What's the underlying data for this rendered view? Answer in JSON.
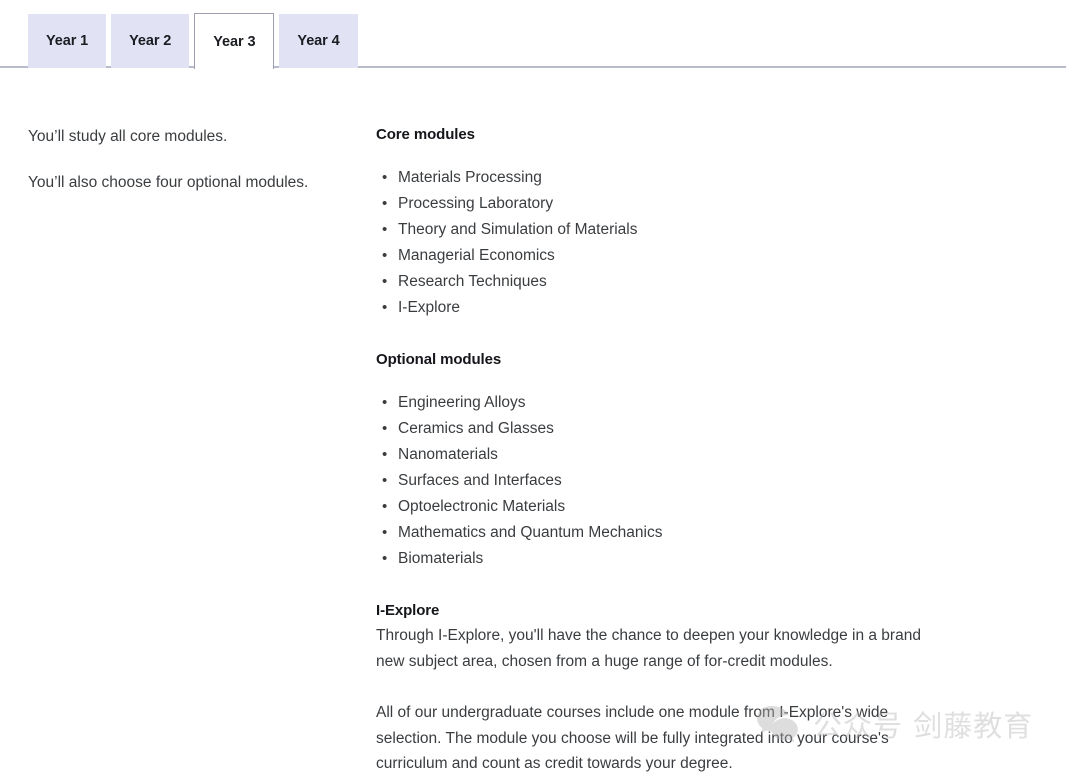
{
  "tabs": {
    "items": [
      {
        "label": "Year 1",
        "active": false
      },
      {
        "label": "Year 2",
        "active": false
      },
      {
        "label": "Year 3",
        "active": true
      },
      {
        "label": "Year 4",
        "active": false
      }
    ],
    "active_label": "Year 3"
  },
  "left_column": {
    "paragraph_1": "You’ll study all core modules.",
    "paragraph_2": "You’ll also choose four optional modules."
  },
  "right_column": {
    "core": {
      "heading": "Core modules",
      "items": [
        "Materials Processing",
        "Processing Laboratory",
        "Theory and Simulation of Materials",
        "Managerial Economics",
        "Research Techniques",
        "I-Explore"
      ]
    },
    "optional": {
      "heading": "Optional modules",
      "items": [
        "Engineering Alloys",
        "Ceramics and Glasses",
        "Nanomaterials",
        "Surfaces and Interfaces",
        "Optoelectronic Materials",
        "Mathematics and Quantum Mechanics",
        "Biomaterials"
      ]
    },
    "iexplore": {
      "heading": "I-Explore",
      "paragraph_1": "Through I-Explore, you'll have the chance to deepen your knowledge in a brand new subject area, chosen from a huge range of for-credit modules.",
      "paragraph_2": "All of our undergraduate courses include one module from I-Explore's wide selection. The module you choose will be fully integrated into your course's curriculum and count as credit towards your degree."
    }
  },
  "watermark": {
    "icon": "wechat-logo-icon",
    "text": "公众号  剑藤教育"
  },
  "colors": {
    "tab_inactive_bg": "#e2e2f5",
    "tab_active_bg": "#ffffff",
    "tab_border": "#9b9fae",
    "rule": "#b9bcc9",
    "heading_text": "#14161a",
    "body_text": "#3a3d40",
    "watermark": "#b4b4b4"
  }
}
